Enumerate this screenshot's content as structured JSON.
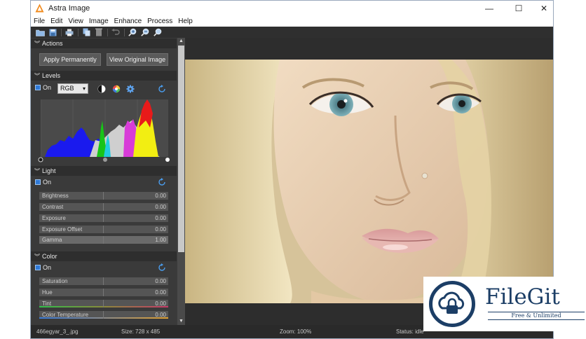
{
  "window": {
    "title": "Astra Image",
    "controls": {
      "minimize": "—",
      "maximize": "☐",
      "close": "✕"
    }
  },
  "menu": [
    "File",
    "Edit",
    "View",
    "Image",
    "Enhance",
    "Process",
    "Help"
  ],
  "toolbar": {
    "icons": [
      "open-folder-icon",
      "save-icon",
      "print-icon",
      "copy-icon",
      "delete-icon",
      "undo-icon",
      "zoom-in-icon",
      "zoom-out-icon",
      "zoom-fit-icon"
    ]
  },
  "panel": {
    "actions": {
      "title": "Actions",
      "apply_button": "Apply Permanently",
      "view_original_button": "View Original Image"
    },
    "levels": {
      "title": "Levels",
      "on_label": "On",
      "channel": "RGB",
      "enabled": true
    },
    "light": {
      "title": "Light",
      "on_label": "On",
      "enabled": true,
      "sliders": [
        {
          "label": "Brightness",
          "value": "0.00"
        },
        {
          "label": "Contrast",
          "value": "0.00"
        },
        {
          "label": "Exposure",
          "value": "0.00"
        },
        {
          "label": "Exposure Offset",
          "value": "0.00"
        },
        {
          "label": "Gamma",
          "value": "1.00"
        }
      ]
    },
    "color": {
      "title": "Color",
      "on_label": "On",
      "enabled": true,
      "sliders": [
        {
          "label": "Saturation",
          "value": "0.00"
        },
        {
          "label": "Hue",
          "value": "0.00"
        },
        {
          "label": "Tint",
          "value": "0.00"
        },
        {
          "label": "Color Temperature",
          "value": "0.00"
        }
      ]
    }
  },
  "status": {
    "file": "466egyar_3_.jpg",
    "size": "Size: 728 x 485",
    "zoom": "Zoom: 100%",
    "status": "Status: idle"
  },
  "watermark": {
    "name": "FileGit",
    "tagline": "Free & Unlimited"
  },
  "colors": {
    "accent": "#2f7ad8",
    "panel_bg": "#3a3a3a",
    "watermark_blue": "#1c3e66"
  }
}
